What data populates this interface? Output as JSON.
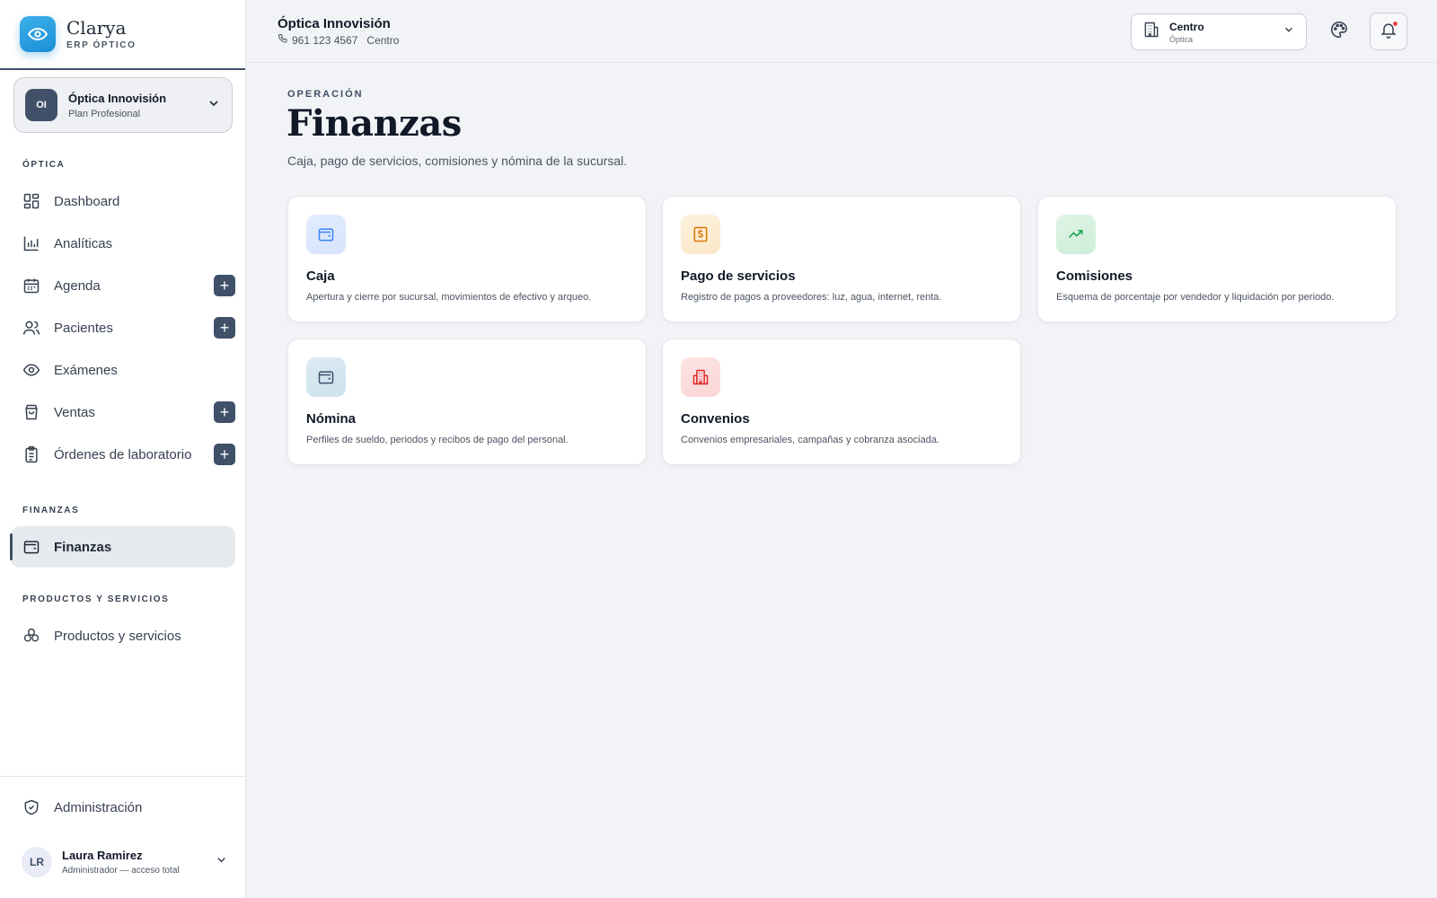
{
  "brand": {
    "name": "Clarya",
    "subtitle": "ERP ÓPTICO"
  },
  "org": {
    "initials": "OI",
    "name": "Óptica Innovisión",
    "plan": "Plan Profesional"
  },
  "sidebar": {
    "sections": {
      "optica": "ÓPTICA",
      "finanzas": "FINANZAS",
      "productos": "PRODUCTOS Y SERVICIOS"
    },
    "items": [
      {
        "label": "Dashboard",
        "icon": "dashboard-grid-icon"
      },
      {
        "label": "Analíticas",
        "icon": "bar-chart-icon"
      },
      {
        "label": "Agenda",
        "icon": "calendar-icon",
        "plus": "+"
      },
      {
        "label": "Pacientes",
        "icon": "users-icon",
        "plus": "+"
      },
      {
        "label": "Exámenes",
        "icon": "eye-icon"
      },
      {
        "label": "Ventas",
        "icon": "shopping-bag-icon",
        "plus": "+"
      },
      {
        "label": "Órdenes de laboratorio",
        "icon": "clipboard-icon",
        "plus": "+"
      },
      {
        "label": "Finanzas",
        "icon": "wallet-icon",
        "active": true
      },
      {
        "label": "Productos y servicios",
        "icon": "boxes-icon"
      }
    ],
    "admin": {
      "label": "Administración",
      "icon": "shield-check-icon"
    }
  },
  "user": {
    "initials": "LR",
    "name": "Laura Ramirez",
    "role": "Administrador — acceso total"
  },
  "topbar": {
    "name": "Óptica Innovisión",
    "phone": "961 123 4567",
    "branch": "Centro",
    "branch_select": {
      "title": "Centro",
      "subtitle": "Óptica"
    }
  },
  "page": {
    "eyebrow": "OPERACIÓN",
    "title": "Finanzas",
    "description": "Caja, pago de servicios, comisiones y nómina de la sucursal."
  },
  "cards": [
    {
      "title": "Caja",
      "description": "Apertura y cierre por sucursal, movimientos de efectivo y arqueo.",
      "icon": "wallet-icon",
      "color": "#3b82f6"
    },
    {
      "title": "Pago de servicios",
      "description": "Registro de pagos a proveedores: luz, agua, internet, renta.",
      "icon": "receipt-dollar-icon",
      "color": "#d97706"
    },
    {
      "title": "Comisiones",
      "description": "Esquema de porcentaje por vendedor y liquidación por periodo.",
      "icon": "trending-up-icon",
      "color": "#16a34a"
    },
    {
      "title": "Nómina",
      "description": "Perfiles de sueldo, periodos y recibos de pago del personal.",
      "icon": "wallet-icon",
      "color": "#0e7490"
    },
    {
      "title": "Convenios",
      "description": "Convenios empresariales, campañas y cobranza asociada.",
      "icon": "building-icon",
      "color": "#dc2626"
    }
  ],
  "colors": {
    "primary": "#3f5068",
    "accent": "#1a8fd6",
    "background": "#f1f3f6"
  }
}
